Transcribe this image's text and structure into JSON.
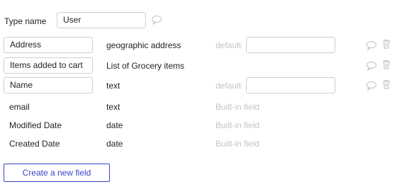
{
  "type_name": {
    "label": "Type name",
    "value": "User"
  },
  "fields": [
    {
      "name": "Address",
      "type": "geographic address",
      "default_label": "default",
      "default_value": ""
    },
    {
      "name": "Items added to cart",
      "type": "List of Grocery items"
    },
    {
      "name": "Name",
      "type": "text",
      "default_label": "default",
      "default_value": ""
    }
  ],
  "builtin_fields": [
    {
      "name": "email",
      "type": "text",
      "note": "Built-in field"
    },
    {
      "name": "Modified Date",
      "type": "date",
      "note": "Built-in field"
    },
    {
      "name": "Created Date",
      "type": "date",
      "note": "Built-in field"
    }
  ],
  "create_button_label": "Create a new field",
  "colors": {
    "accent": "#3b44c9",
    "muted_text": "#c4c4c4",
    "border": "#cfcfcf",
    "icon": "#c8c8c8"
  }
}
